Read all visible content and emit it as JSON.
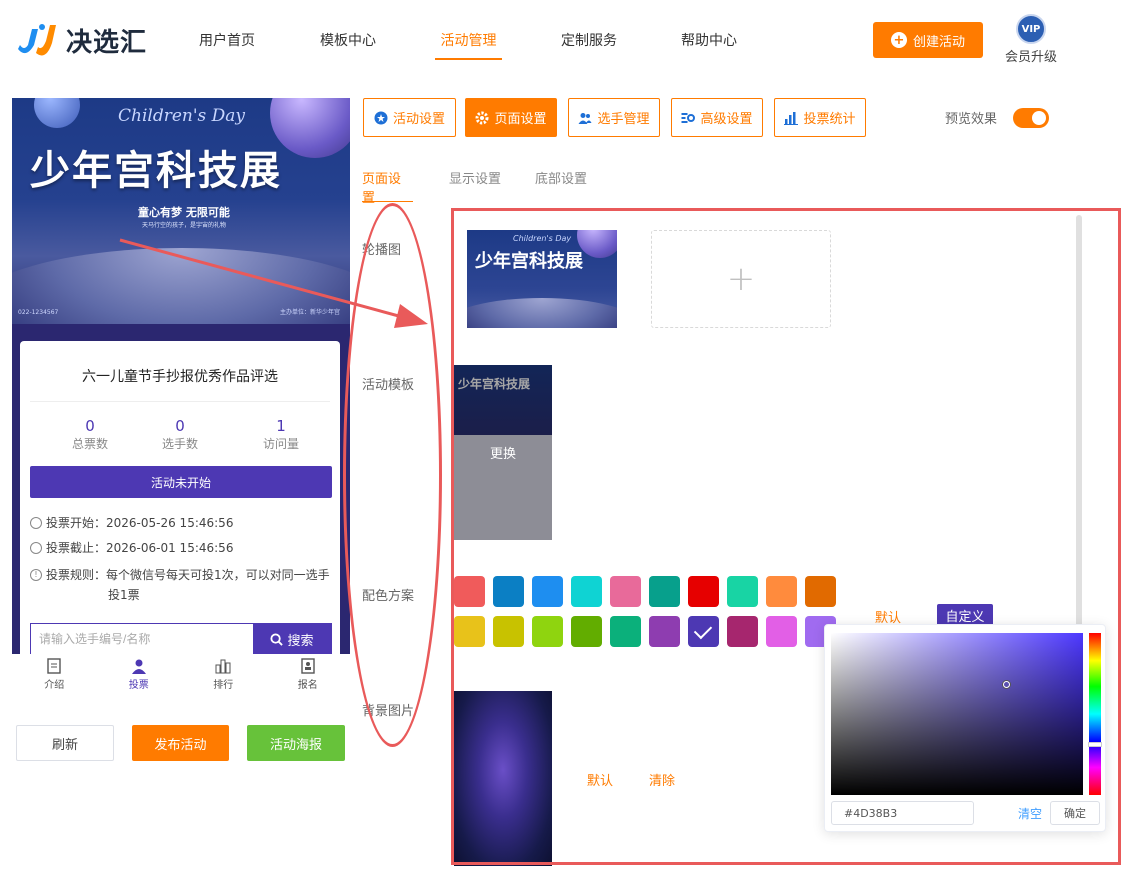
{
  "header": {
    "brand": "决选汇",
    "nav": [
      {
        "label": "用户首页"
      },
      {
        "label": "模板中心"
      },
      {
        "label": "活动管理"
      },
      {
        "label": "定制服务"
      },
      {
        "label": "帮助中心"
      }
    ],
    "create_label": "创建活动",
    "vip_badge": "VIP",
    "vip_label": "会员升级"
  },
  "preview": {
    "banner": {
      "subtitle": "Children's Day",
      "title": "少年宫科技展",
      "slogan": "童心有梦 无限可能",
      "tagline": "天马行空的孩子，是宇宙的礼物",
      "foot_left": "022-1234567",
      "foot_right": "主办单位：新华少年宫"
    },
    "activity_title": "六一儿童节手抄报优秀作品评选",
    "stats": [
      {
        "value": "0",
        "label": "总票数"
      },
      {
        "value": "0",
        "label": "选手数"
      },
      {
        "value": "1",
        "label": "访问量"
      }
    ],
    "status": "活动未开始",
    "vote_start": "投票开始：2026-05-26 15:46:56",
    "vote_end": "投票截止：2026-06-01 15:46:56",
    "vote_rule_1": "投票规则：每个微信号每天可投1次，可以对同一选手",
    "vote_rule_2": "投1票",
    "search_placeholder": "请输入选手编号/名称",
    "search_button": "搜索",
    "tabs": [
      {
        "label": "介绍",
        "icon": "doc-icon"
      },
      {
        "label": "投票",
        "icon": "user-icon"
      },
      {
        "label": "排行",
        "icon": "rank-icon"
      },
      {
        "label": "报名",
        "icon": "signup-icon"
      }
    ],
    "buttons": {
      "refresh": "刷新",
      "publish": "发布活动",
      "poster": "活动海报"
    }
  },
  "settings": {
    "tabs": [
      {
        "label": "活动设置",
        "icon": "star-icon"
      },
      {
        "label": "页面设置",
        "icon": "gear-icon"
      },
      {
        "label": "选手管理",
        "icon": "users-icon"
      },
      {
        "label": "高级设置",
        "icon": "settings-icon"
      },
      {
        "label": "投票统计",
        "icon": "chart-icon"
      }
    ],
    "preview_label": "预览效果",
    "preview_on": true,
    "subtabs": [
      "页面设置",
      "显示设置",
      "底部设置"
    ],
    "sections": {
      "carousel": "轮播图",
      "template": "活动模板",
      "color": "配色方案",
      "background": "背景图片"
    },
    "template_replace": "更换",
    "color_default": "默认",
    "color_custom": "自定义",
    "bg_default": "默认",
    "bg_clear": "清除",
    "swatches": [
      "#f05b5b",
      "#0b7fc4",
      "#1e8ef0",
      "#0fd3d3",
      "#e86a9a",
      "#07a08c",
      "#e60000",
      "#18d4a4",
      "#ff8b3d",
      "#e16a00",
      "#e8c21a",
      "#c8c200",
      "#8fd40f",
      "#62ad00",
      "#0bb07b",
      "#8e3db0",
      "#4d38b3",
      "#a6266e",
      "#e25fe6",
      "#a06bf0"
    ],
    "selected_swatch": 16
  },
  "color_picker": {
    "hex": "#4D38B3",
    "clear": "清空",
    "confirm": "确定"
  }
}
